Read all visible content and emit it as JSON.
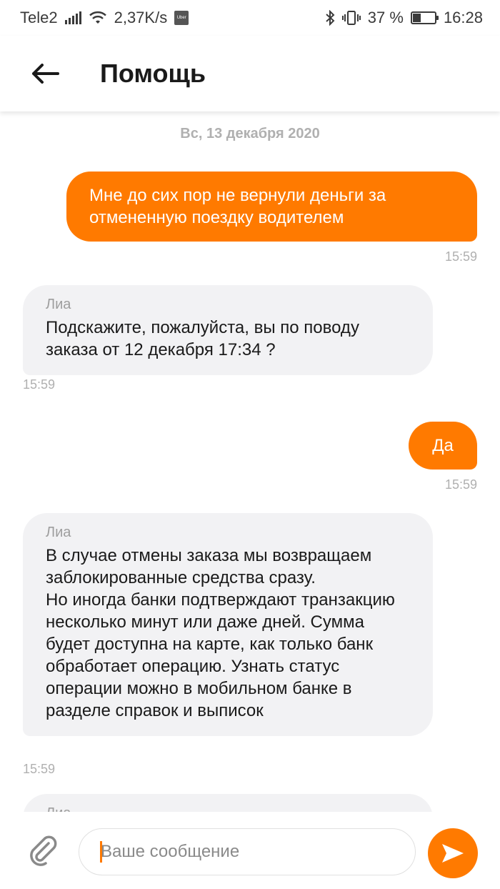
{
  "status_bar": {
    "carrier": "Tele2",
    "speed": "2,37K/s",
    "app_badge": "Uber",
    "battery": "37 %",
    "battery_level": 0.37,
    "time": "16:28"
  },
  "header": {
    "title": "Помощь"
  },
  "chat": {
    "date": "Вс, 13 декабря 2020",
    "messages": [
      {
        "direction": "out",
        "text": "Мне до сих пор не вернули деньги за отмененную поездку водителем",
        "time": "15:59"
      },
      {
        "direction": "in",
        "sender": "Лиа",
        "text": "Подскажите, пожалуйста, вы по поводу заказа от 12 декабря 17:34 ?",
        "time": "15:59"
      },
      {
        "direction": "out",
        "text": "Да",
        "time": "15:59"
      },
      {
        "direction": "in",
        "sender": "Лиа",
        "text": "В случае отмены заказа мы возвращаем заблокированные средства сразу.\nНо иногда банки подтверждают транзакцию несколько минут или даже дней. Сумма будет доступна на карте, как только банк обработает операцию. Узнать статус операции можно в мобильном банке в разделе справок и выписок",
        "time": "15:59"
      },
      {
        "direction": "in",
        "sender": "Лиа"
      }
    ]
  },
  "input": {
    "placeholder": "Ваше сообщение",
    "value": ""
  },
  "colors": {
    "accent": "#ff7a00",
    "incoming_bubble": "#f2f2f4",
    "muted_text": "#b0b0b0"
  },
  "icons": {
    "back": "arrow-left-icon",
    "attach": "paperclip-icon",
    "send": "send-arrow-icon"
  }
}
